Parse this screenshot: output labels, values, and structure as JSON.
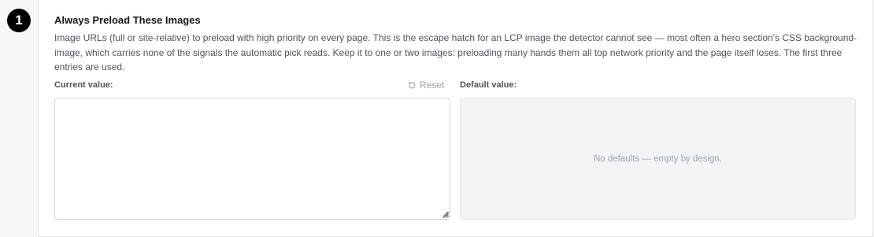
{
  "step": {
    "number": "1"
  },
  "setting": {
    "title": "Always Preload These Images",
    "description": "Image URLs (full or site-relative) to preload with high priority on every page. This is the escape hatch for an LCP image the detector cannot see — most often a hero section's CSS background-image, which carries none of the signals the automatic pick reads. Keep it to one or two images: preloading many hands them all top network priority and the page itself loses. The first three entries are used."
  },
  "current": {
    "label": "Current value:",
    "value": "",
    "placeholder": ""
  },
  "reset": {
    "label": "Reset",
    "icon": "reset-icon"
  },
  "default": {
    "label": "Default value:",
    "text": "No defaults — empty by design."
  },
  "colors": {
    "badge_bg": "#000000",
    "page_bg": "#f7f7f8",
    "muted_text": "#a1a1aa"
  }
}
